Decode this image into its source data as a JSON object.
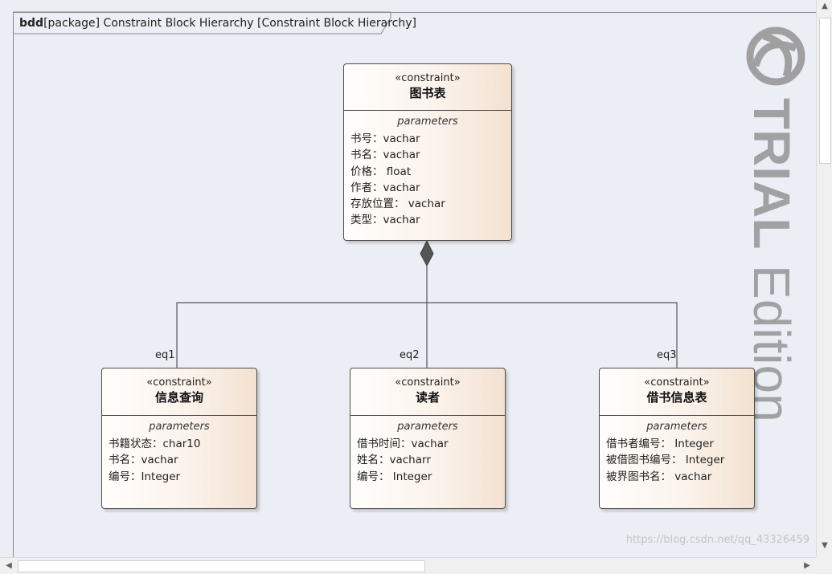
{
  "frame": {
    "kind": "bdd",
    "rest": "[package] Constraint Block Hierarchy [Constraint Block Hierarchy]"
  },
  "blocks": {
    "root": {
      "stereotype": "«constraint»",
      "name": "图书表",
      "compartment": "parameters",
      "params": [
        "书号：vachar",
        "书名：vachar",
        "价格：  float",
        "作者：vachar",
        "存放位置：  vachar",
        "类型：vachar"
      ]
    },
    "b1": {
      "stereotype": "«constraint»",
      "name": "信息查询",
      "compartment": "parameters",
      "params": [
        "书籍状态：char10",
        "书名：vachar",
        "编号：Integer"
      ]
    },
    "b2": {
      "stereotype": "«constraint»",
      "name": "读者",
      "compartment": "parameters",
      "params": [
        "借书时间：vachar",
        "姓名：vacharr",
        "编号：  Integer"
      ]
    },
    "b3": {
      "stereotype": "«constraint»",
      "name": "借书信息表",
      "compartment": "parameters",
      "params": [
        "借书者编号：  Integer",
        "被借图书编号：  Integer",
        "被界图书名：  vachar"
      ]
    }
  },
  "roles": {
    "eq1": "eq1",
    "eq2": "eq2",
    "eq3": "eq3"
  },
  "watermark": {
    "word1": "TRIAL",
    "word2": "Edition",
    "url": "https://blog.csdn.net/qq_43326459"
  },
  "colors": {
    "canvas": "#eceef5",
    "block_border": "#4d4d4d",
    "watermark": "#9a9a9a"
  }
}
